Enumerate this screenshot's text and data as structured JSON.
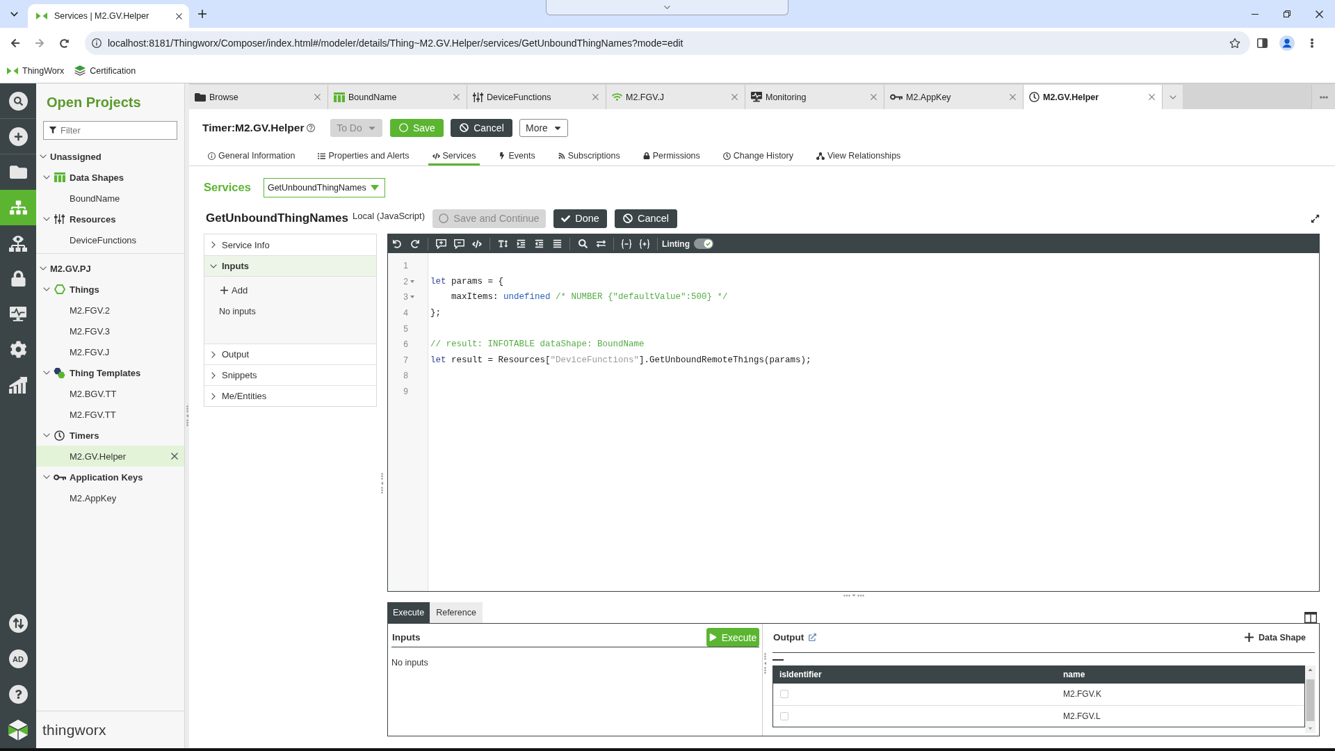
{
  "browser": {
    "tab_title": "Services | M2.GV.Helper",
    "url": "localhost:8181/Thingworx/Composer/index.html#/modeler/details/Thing~M2.GV.Helper/services/GetUnboundThingNames?mode=edit",
    "bookmarks": [
      "ThingWorx",
      "Certification"
    ]
  },
  "nav_rail": {
    "items": [
      {
        "selected": false
      },
      {
        "selected": false
      },
      {
        "selected": false
      },
      {
        "selected": true
      },
      {
        "selected": false
      },
      {
        "selected": false
      },
      {
        "selected": false
      },
      {
        "selected": false
      },
      {
        "selected": false
      }
    ],
    "user_initials": "AD",
    "brand": "thingworx"
  },
  "projects": {
    "title": "Open Projects",
    "filter_placeholder": "Filter",
    "groups": [
      {
        "name": "Unassigned",
        "expanded": true,
        "children": [
          {
            "name": "Data Shapes",
            "kind": "data-shapes",
            "expanded": true,
            "children": [
              {
                "name": "BoundName",
                "selected": false
              }
            ]
          },
          {
            "name": "Resources",
            "kind": "resources",
            "expanded": true,
            "children": [
              {
                "name": "DeviceFunctions",
                "selected": false
              }
            ]
          }
        ]
      },
      {
        "name": "M2.GV.PJ",
        "expanded": true,
        "children": [
          {
            "name": "Things",
            "kind": "things",
            "expanded": true,
            "children": [
              {
                "name": "M2.FGV.2",
                "selected": false
              },
              {
                "name": "M2.FGV.3",
                "selected": false
              },
              {
                "name": "M2.FGV.J",
                "selected": false
              }
            ]
          },
          {
            "name": "Thing Templates",
            "kind": "thing-templates",
            "expanded": true,
            "children": [
              {
                "name": "M2.BGV.TT",
                "selected": false
              },
              {
                "name": "M2.FGV.TT",
                "selected": false
              }
            ]
          },
          {
            "name": "Timers",
            "kind": "timers",
            "expanded": true,
            "children": [
              {
                "name": "M2.GV.Helper",
                "selected": true
              }
            ]
          },
          {
            "name": "Application Keys",
            "kind": "application-keys",
            "expanded": true,
            "children": [
              {
                "name": "M2.AppKey",
                "selected": false
              }
            ]
          }
        ]
      }
    ]
  },
  "entity_tabs": [
    {
      "label": "Browse",
      "kind": "browse",
      "selected": false
    },
    {
      "label": "BoundName",
      "kind": "data-shape",
      "selected": false
    },
    {
      "label": "DeviceFunctions",
      "kind": "resource",
      "selected": false
    },
    {
      "label": "M2.FGV.J",
      "kind": "thing",
      "selected": false
    },
    {
      "label": "Monitoring",
      "kind": "monitoring",
      "selected": false
    },
    {
      "label": "M2.AppKey",
      "kind": "application-key",
      "selected": false
    },
    {
      "label": "M2.GV.Helper",
      "kind": "timer",
      "selected": true
    }
  ],
  "entity": {
    "title": "Timer:M2.GV.Helper",
    "state_button": {
      "label": "To Do",
      "disabled": true
    },
    "buttons": [
      {
        "label": "Save",
        "kind": "save"
      },
      {
        "label": "Cancel",
        "kind": "cancel"
      },
      {
        "label": "More",
        "kind": "more"
      }
    ]
  },
  "detail_tabs": [
    {
      "label": "General Information",
      "selected": false
    },
    {
      "label": "Properties and Alerts",
      "selected": false
    },
    {
      "label": "Services",
      "selected": true
    },
    {
      "label": "Events",
      "selected": false
    },
    {
      "label": "Subscriptions",
      "selected": false
    },
    {
      "label": "Permissions",
      "selected": false
    },
    {
      "label": "Change History",
      "selected": false
    },
    {
      "label": "View Relationships",
      "selected": false
    }
  ],
  "services": {
    "label": "Services",
    "selected_service": "GetUnboundThingNames",
    "service": {
      "name": "GetUnboundThingNames",
      "type": "Local (JavaScript)",
      "buttons": [
        {
          "label": "Save and Continue",
          "kind": "save",
          "disabled": true
        },
        {
          "label": "Done",
          "kind": "done",
          "disabled": false
        },
        {
          "label": "Cancel",
          "kind": "cancel",
          "disabled": false
        }
      ]
    },
    "sections": [
      {
        "title": "Service Info",
        "expanded": false
      },
      {
        "title": "Inputs",
        "expanded": true,
        "add_label": "Add",
        "empty_text": "No inputs"
      },
      {
        "title": "Output",
        "expanded": false
      },
      {
        "title": "Snippets",
        "expanded": false
      },
      {
        "title": "Me/Entities",
        "expanded": false
      }
    ],
    "editor": {
      "linting": {
        "label": "Linting",
        "on": true
      },
      "lines": [
        {
          "number": "1",
          "foldable": false
        },
        {
          "number": "2",
          "foldable": true,
          "tokens": [
            {
              "text": "let",
              "kind": "keyword"
            },
            {
              "text": " params = {",
              "kind": "plain"
            }
          ]
        },
        {
          "number": "3",
          "foldable": true,
          "tokens": [
            {
              "text": "    maxItems: ",
              "kind": "plain"
            },
            {
              "text": "undefined",
              "kind": "atom"
            },
            {
              "text": " /* NUMBER {\"defaultValue\":500} */",
              "kind": "comment"
            }
          ]
        },
        {
          "number": "4",
          "foldable": false,
          "tokens": [
            {
              "text": "};",
              "kind": "plain"
            }
          ]
        },
        {
          "number": "5",
          "foldable": false
        },
        {
          "number": "6",
          "foldable": false,
          "tokens": [
            {
              "text": "// result: INFOTABLE dataShape: BoundName",
              "kind": "comment"
            }
          ]
        },
        {
          "number": "7",
          "foldable": false,
          "tokens": [
            {
              "text": "let",
              "kind": "keyword"
            },
            {
              "text": " result = Resources[",
              "kind": "plain"
            },
            {
              "text": "\"DeviceFunctions\"",
              "kind": "string"
            },
            {
              "text": "].GetUnboundRemoteThings(params);",
              "kind": "plain"
            }
          ]
        },
        {
          "number": "8",
          "foldable": false
        },
        {
          "number": "9",
          "foldable": false
        }
      ]
    }
  },
  "test_panel": {
    "tabs": [
      {
        "label": "Execute",
        "selected": true
      },
      {
        "label": "Reference",
        "selected": false
      }
    ],
    "inputs": {
      "title": "Inputs",
      "execute_label": "Execute",
      "empty_text": "No inputs"
    },
    "output": {
      "title": "Output",
      "add_label": "Data Shape",
      "table": {
        "columns": [
          "isIdentifier",
          "name"
        ],
        "rows": [
          {
            "checked": false,
            "name": "M2.FGV.K"
          },
          {
            "checked": false,
            "name": "M2.FGV.L"
          }
        ]
      }
    }
  }
}
